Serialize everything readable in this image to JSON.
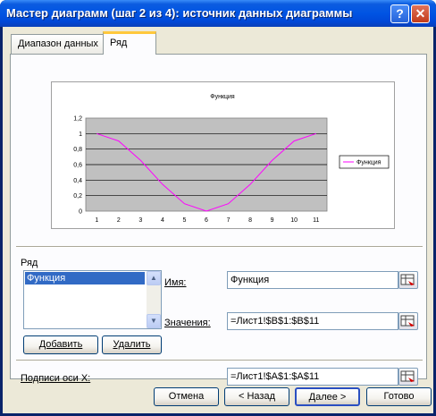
{
  "window": {
    "title": "Мастер диаграмм (шаг 2 из 4): источник данных диаграммы",
    "help_label": "?",
    "close_label": "✕"
  },
  "tabs": [
    {
      "label": "Диапазон данных",
      "active": false
    },
    {
      "label": "Ряд",
      "active": true
    }
  ],
  "chart_data": {
    "type": "line",
    "title": "Функция",
    "categories": [
      "1",
      "2",
      "3",
      "4",
      "5",
      "6",
      "7",
      "8",
      "9",
      "10",
      "11"
    ],
    "series": [
      {
        "name": "Функция",
        "color": "#ff00ff",
        "values": [
          1,
          0.9045,
          0.6545,
          0.3455,
          0.0955,
          0,
          0.0955,
          0.3455,
          0.6545,
          0.9045,
          1
        ]
      }
    ],
    "y_ticks": [
      "0",
      "0,2",
      "0,4",
      "0,6",
      "0,8",
      "1",
      "1,2"
    ],
    "ylim": [
      0,
      1.2
    ],
    "grid": true,
    "plot_bg": "#c0c0c0",
    "legend": "right"
  },
  "series_section": {
    "label": "Ряд",
    "items": [
      "Функция"
    ],
    "add_label": "Добавить",
    "remove_label": "Удалить"
  },
  "fields": {
    "name_label": "Имя:",
    "name_value": "Функция",
    "values_label": "Значения:",
    "values_value": "=Лист1!$B$1:$B$11",
    "xlabels_label": "Подписи оси X:",
    "xlabels_value": "=Лист1!$A$1:$A$11"
  },
  "buttons": {
    "cancel": "Отмена",
    "back": "< Назад",
    "next": "Далее >",
    "finish": "Готово"
  },
  "icons": {
    "scroll_up": "▲",
    "scroll_down": "▼",
    "range_ref": "range-select-icon"
  }
}
